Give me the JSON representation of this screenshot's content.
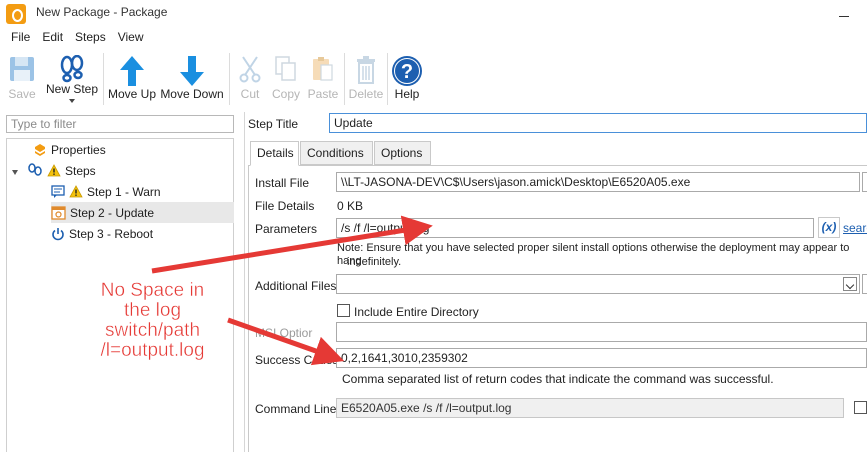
{
  "window": {
    "title": "New Package - Package"
  },
  "menu": [
    "File",
    "Edit",
    "Steps",
    "View"
  ],
  "toolbar": {
    "save": "Save",
    "new_step": "New Step",
    "move_up": "Move Up",
    "move_down": "Move Down",
    "cut": "Cut",
    "copy": "Copy",
    "paste": "Paste",
    "delete": "Delete",
    "help": "Help"
  },
  "filter": {
    "placeholder": "Type to filter"
  },
  "tree": {
    "properties": "Properties",
    "steps": "Steps",
    "step1": "Step 1 - Warn",
    "step2": "Step 2 - Update",
    "step3": "Step 3 - Reboot"
  },
  "step_title": {
    "label": "Step Title",
    "value": "Update"
  },
  "tabs": [
    "Details",
    "Conditions",
    "Options"
  ],
  "details": {
    "install_file_label": "Install File",
    "install_file_value": "\\\\LT-JASONA-DEV\\C$\\Users\\jason.amick\\Desktop\\E6520A05.exe",
    "file_details_label": "File Details",
    "file_details_value": "0 KB",
    "parameters_label": "Parameters",
    "parameters_value": "/s /f /l=output.log",
    "var_button": "(x)",
    "search_link": "searc",
    "note_line1": "Note: Ensure that you have selected proper silent install options otherwise the deployment may appear to hang",
    "note_line2": "indefinitely.",
    "additional_files_label": "Additional Files",
    "include_entire_directory": "Include Entire Directory",
    "msi_options_label": "MSI Optior",
    "success_codes_label": "Success Codes",
    "success_codes_value": "0,2,1641,3010,2359302",
    "success_codes_hint": "Comma separated list of return codes that indicate the command was successful.",
    "command_line_label": "Command Line",
    "command_line_value": "E6520A05.exe /s /f /l=output.log"
  },
  "annotation": {
    "line1": "No Space in",
    "line2": "the log",
    "line3": "switch/path",
    "line4": "/l=output.log",
    "color": "#e53935"
  },
  "colors": {
    "accent": "#1d5fb0",
    "logo": "#f39c12",
    "warn": "#f4c20d"
  }
}
